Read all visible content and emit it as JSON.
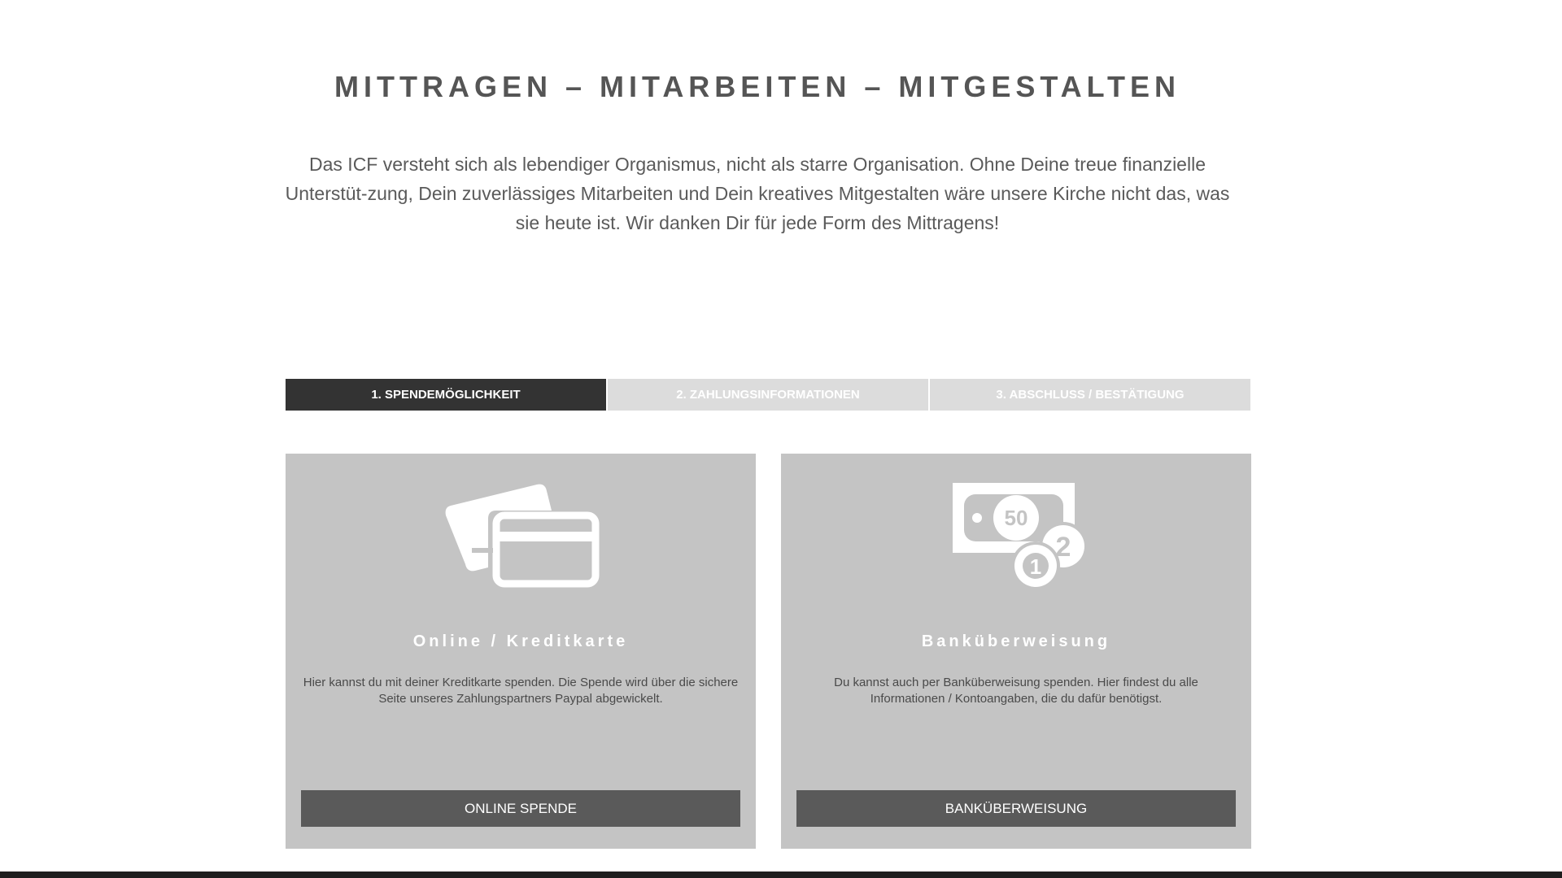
{
  "header": {
    "title": "MITTRAGEN – MITARBEITEN – MITGESTALTEN",
    "intro": "Das ICF versteht sich als lebendiger Organismus, nicht als starre Organisation. Ohne Deine treue finanzielle Unterstüt-zung, Dein zuverlässiges Mitarbeiten und Dein kreatives Mitgestalten wäre unsere Kirche nicht das, was sie heute ist. Wir danken Dir für jede Form des Mittragens!"
  },
  "steps": [
    {
      "label": "1. SPENDEMÖGLICHKEIT",
      "active": true
    },
    {
      "label": "2. ZAHLUNGSINFORMATIONEN",
      "active": false
    },
    {
      "label": "3. ABSCHLUSS / BESTÄTIGUNG",
      "active": false
    }
  ],
  "cards": [
    {
      "icon": "credit-card-icon",
      "title": "Online / Kreditkarte",
      "text": "Hier kannst du mit deiner Kreditkarte spenden. Die Spende wird über die sichere Seite unseres Zahlungspartners Paypal abgewickelt.",
      "button": "ONLINE SPENDE"
    },
    {
      "icon": "money-coins-icon",
      "icon_text": {
        "bill": "50",
        "coin_a": "2",
        "coin_b": "1"
      },
      "title": "Banküberweisung",
      "text": "Du kannst auch per Banküberweisung spenden. Hier findest du alle Informationen / Kontoangaben, die du dafür benötigst.",
      "button": "BANKÜBERWEISUNG"
    }
  ],
  "colors": {
    "active_step": "#333333",
    "inactive_step": "#dcdcdc",
    "card_background": "#c4c4c4",
    "button_background": "#5a5a5a",
    "text": "#555555"
  }
}
